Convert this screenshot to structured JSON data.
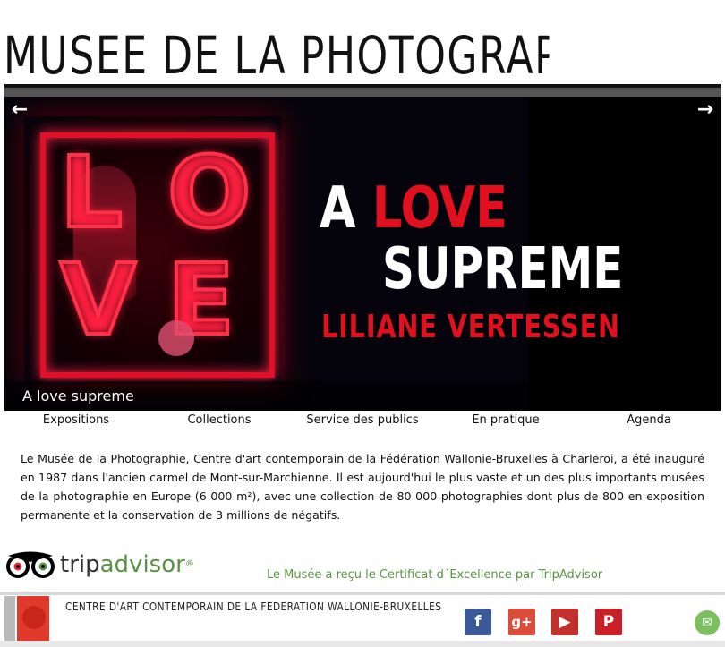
{
  "header": {
    "site_title": "MUSEE DE LA PHOTOGRAPHIE"
  },
  "slider": {
    "prev_glyph": "←",
    "next_glyph": "→",
    "poster": {
      "line1_word1": "A",
      "line1_word2": "LOVE",
      "line2": "SUPREME",
      "line3": "LILIANE VERTESSEN",
      "neon_letters": [
        "L",
        "O",
        "V",
        "E"
      ]
    },
    "caption": "A love supreme"
  },
  "nav": {
    "items": [
      {
        "label": "Expositions"
      },
      {
        "label": "Collections"
      },
      {
        "label": "Service des publics"
      },
      {
        "label": "En pratique"
      },
      {
        "label": "Agenda"
      }
    ]
  },
  "intro": {
    "text": "Le Musée de la Photographie, Centre d'art contemporain de la Fédération Wallonie-Bruxelles à Charleroi, a été inauguré en 1987 dans l'ancien carmel de Mont-sur-Marchienne. Il est aujourd'hui le plus vaste et un des plus importants musées de la photographie en Europe (6 000 m²), avec une collection de 80 000 photographies dont plus de 800 en exposition permanente et la conservation de 3 millions de négatifs."
  },
  "tripadvisor": {
    "logo_word_trip": "trip",
    "logo_word_advisor": "advisor",
    "logo_reg": "®",
    "certificate_text": "Le Musée a reçu le Certificat d´Excellence par TripAdvisor"
  },
  "footer": {
    "fwb_text": "CENTRE D'ART CONTEMPORAIN DE LA FEDERATION WALLONIE-BRUXELLES",
    "social": [
      {
        "name": "facebook",
        "glyph": "f"
      },
      {
        "name": "google-plus",
        "glyph": "g+"
      },
      {
        "name": "youtube",
        "glyph": "▶"
      },
      {
        "name": "pinterest",
        "glyph": "P"
      }
    ],
    "chat_glyph": "✉"
  },
  "colors": {
    "accent_red": "#e0101f",
    "tripadvisor_green": "#589442",
    "facebook": "#3b5998",
    "google_plus": "#dd4b39",
    "youtube": "#c4302b",
    "pinterest": "#cb2027"
  }
}
